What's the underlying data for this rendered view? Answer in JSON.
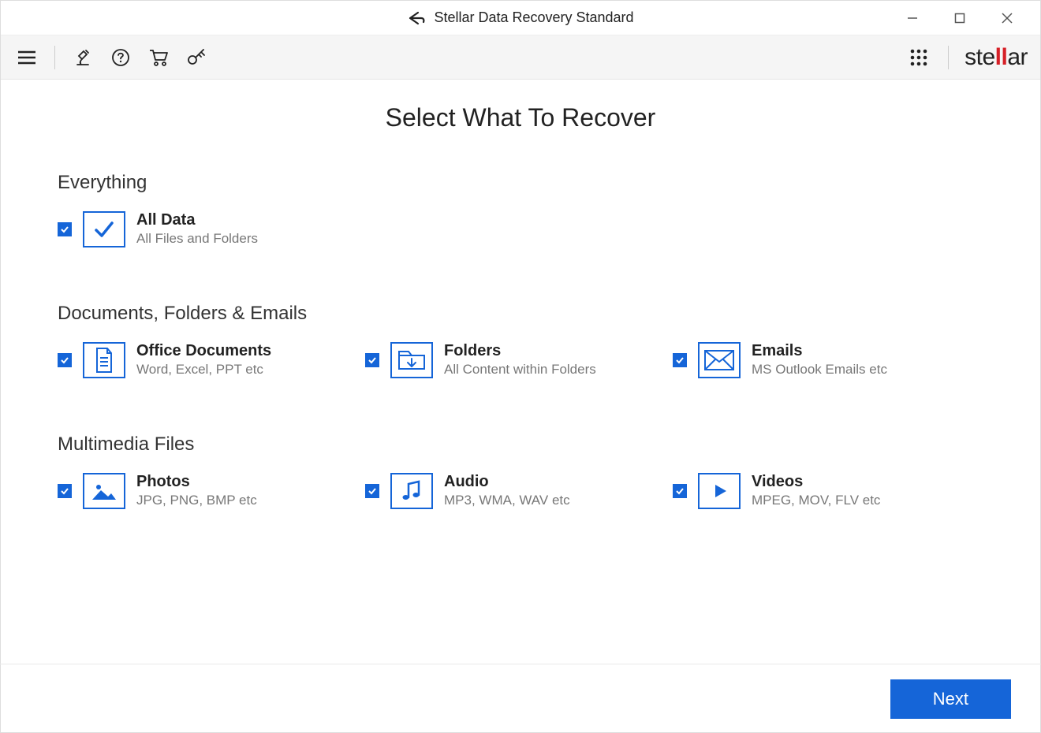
{
  "window": {
    "title": "Stellar Data Recovery Standard"
  },
  "brand": {
    "pre": "ste",
    "mid": "ll",
    "post": "ar"
  },
  "page": {
    "title": "Select What To Recover"
  },
  "sections": {
    "everything": {
      "title": "Everything",
      "all_data": {
        "title": "All Data",
        "sub": "All Files and Folders"
      }
    },
    "docs": {
      "title": "Documents, Folders & Emails",
      "office": {
        "title": "Office Documents",
        "sub": "Word, Excel, PPT etc"
      },
      "folders": {
        "title": "Folders",
        "sub": "All Content within Folders"
      },
      "emails": {
        "title": "Emails",
        "sub": "MS Outlook Emails etc"
      }
    },
    "multimedia": {
      "title": "Multimedia Files",
      "photos": {
        "title": "Photos",
        "sub": "JPG, PNG, BMP etc"
      },
      "audio": {
        "title": "Audio",
        "sub": "MP3, WMA, WAV etc"
      },
      "videos": {
        "title": "Videos",
        "sub": "MPEG, MOV, FLV etc"
      }
    }
  },
  "footer": {
    "next": "Next"
  }
}
